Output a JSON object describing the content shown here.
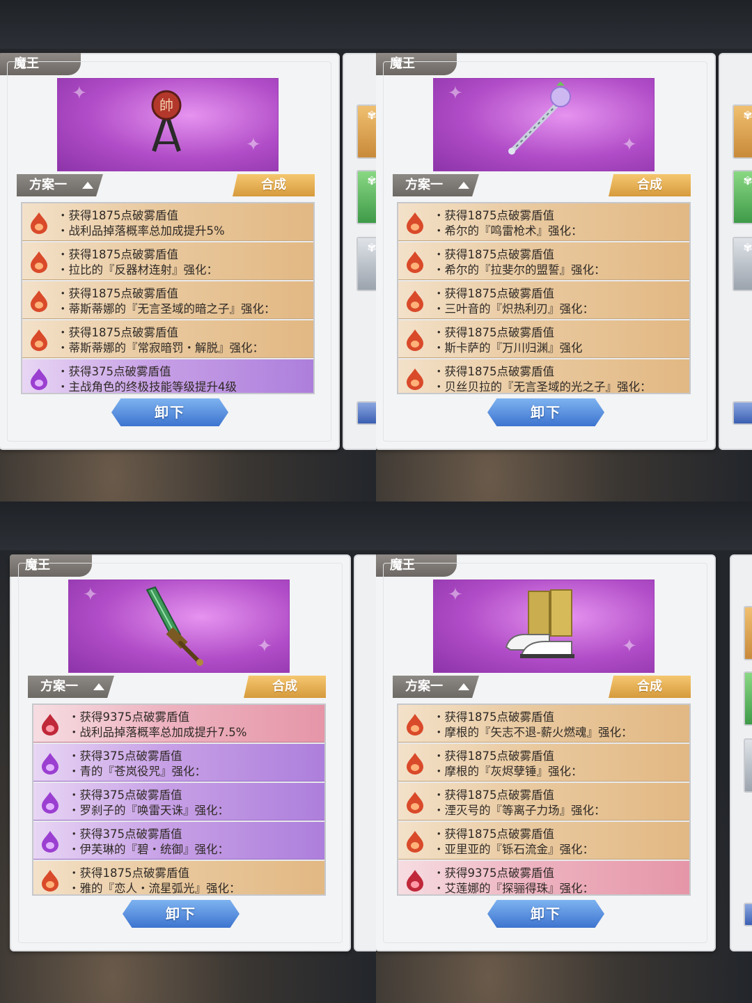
{
  "panels": [
    {
      "title": "魔王",
      "item_icon": "commander-seal-icon",
      "plan_label": "方案一",
      "craft_label": "合成",
      "unload_label": "卸下",
      "rows": [
        {
          "color": "orange",
          "line1": "・获得1875点破雾盾值",
          "line2": "・战利品掉落概率总加成提升5%",
          "line3": ""
        },
        {
          "color": "orange",
          "line1": "・获得1875点破雾盾值",
          "line2": "・拉比的『反器材连射』强化：",
          "line3": ""
        },
        {
          "color": "orange",
          "line1": "・获得1875点破雾盾值",
          "line2": "・蒂斯蒂娜的『无言圣域的暗之子』强化：",
          "line3": ""
        },
        {
          "color": "orange",
          "line1": "・获得1875点破雾盾值",
          "line2": "・蒂斯蒂娜的『常寂暗罚・解脱』强化：",
          "line3": ""
        },
        {
          "color": "purple",
          "line1": "・获得375点破雾盾值",
          "line2": "・主战角色的终极技能等级提升4级",
          "line3": ""
        }
      ]
    },
    {
      "title": "魔王",
      "item_icon": "crystal-scepter-icon",
      "plan_label": "方案一",
      "craft_label": "合成",
      "unload_label": "卸下",
      "rows": [
        {
          "color": "orange",
          "line1": "・获得1875点破雾盾值",
          "line2": "・希尔的『鸣雷枪术』强化：",
          "line3": ""
        },
        {
          "color": "orange",
          "line1": "・获得1875点破雾盾值",
          "line2": "・希尔的『拉斐尔的盟誓』强化：",
          "line3": ""
        },
        {
          "color": "orange",
          "line1": "・获得1875点破雾盾值",
          "line2": "・三叶音的『炽热利刃』强化：",
          "line3": ""
        },
        {
          "color": "orange",
          "line1": "・获得1875点破雾盾值",
          "line2": "・斯卡萨的『万川归渊』强化",
          "line3": ""
        },
        {
          "color": "orange",
          "line1": "・获得1875点破雾盾值",
          "line2": "・贝丝贝拉的『无言圣域的光之子』强化：",
          "line3": ""
        }
      ]
    },
    {
      "title": "魔王",
      "item_icon": "jade-sword-icon",
      "plan_label": "方案一",
      "craft_label": "合成",
      "unload_label": "卸下",
      "rows": [
        {
          "color": "pink",
          "line1": "・获得9375点破雾盾值",
          "line2": "・战利品掉落概率总加成提升7.5%",
          "line3": ""
        },
        {
          "color": "purple",
          "line1": "・获得375点破雾盾值",
          "line2": "・青的『苍岚役咒』强化：",
          "line3": ""
        },
        {
          "color": "purple",
          "line1": "・获得375点破雾盾值",
          "line2": "・罗刹子的『唤雷天诛』强化：",
          "line3": ""
        },
        {
          "color": "purple",
          "line1": "・获得375点破雾盾值",
          "line2": "・伊芙琳的『碧・统御』强化：",
          "line3": ""
        },
        {
          "color": "orange",
          "line1": "・获得1875点破雾盾值",
          "line2": "・雅的『恋人・流星弧光』强化：",
          "line3": ""
        }
      ]
    },
    {
      "title": "魔王",
      "item_icon": "golden-boots-icon",
      "plan_label": "方案一",
      "craft_label": "合成",
      "unload_label": "卸下",
      "rows": [
        {
          "color": "orange",
          "line1": "・获得1875点破雾盾值",
          "line2": "・摩根的『矢志不退-薪火燃魂』强化：",
          "line3": ""
        },
        {
          "color": "orange",
          "line1": "・获得1875点破雾盾值",
          "line2": "・摩根的『灰烬孽锤』强化：",
          "line3": ""
        },
        {
          "color": "orange",
          "line1": "・获得1875点破雾盾值",
          "line2": "・湮灭号的『等离子力场』强化：",
          "line3": ""
        },
        {
          "color": "orange",
          "line1": "・获得1875点破雾盾值",
          "line2": "・亚里亚的『铄石流金』强化：",
          "line3": ""
        },
        {
          "color": "pink",
          "line1": "・获得9375点破雾盾值",
          "line2": "・艾莲娜的『探骊得珠』强化：",
          "line3": ""
        }
      ]
    }
  ],
  "colors": {
    "orange": "#e2b883",
    "purple": "#ad7fdc",
    "pink": "#e596a8",
    "accent_blue": "#3d74cf",
    "gold": "#d69a3c"
  }
}
